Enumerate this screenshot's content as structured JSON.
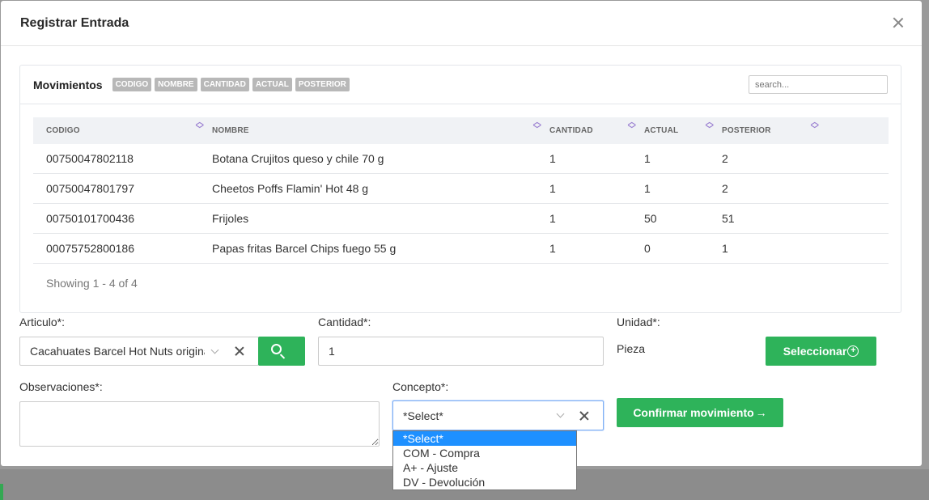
{
  "modal": {
    "title": "Registrar Entrada"
  },
  "movimientos": {
    "title": "Movimientos",
    "chips": [
      "CODIGO",
      "NOMBRE",
      "CANTIDAD",
      "ACTUAL",
      "POSTERIOR"
    ],
    "search_placeholder": "search...",
    "columns": [
      "CODIGO",
      "NOMBRE",
      "CANTIDAD",
      "ACTUAL",
      "POSTERIOR"
    ],
    "rows": [
      [
        "00750047802118",
        "Botana Crujitos queso y chile 70 g",
        "1",
        "1",
        "2"
      ],
      [
        "00750047801797",
        "Cheetos Poffs Flamin' Hot 48 g",
        "1",
        "1",
        "2"
      ],
      [
        "00750101700436",
        "Frijoles",
        "1",
        "50",
        "51"
      ],
      [
        "00075752800186",
        "Papas fritas Barcel Chips fuego 55 g",
        "1",
        "0",
        "1"
      ]
    ],
    "showing": "Showing 1 - 4 of 4"
  },
  "form": {
    "articulo_label": "Articulo*:",
    "articulo_value": "Cacahuates Barcel Hot Nuts original",
    "cantidad_label": "Cantidad*:",
    "cantidad_value": "1",
    "unidad_label": "Unidad*:",
    "unidad_value": "Pieza",
    "seleccionar_label": "Seleccionar",
    "observaciones_label": "Observaciones*:",
    "concepto_label": "Concepto*:",
    "concepto_value": "*Select*",
    "concepto_options": [
      "*Select*",
      "COM - Compra",
      "A+ - Ajuste",
      "DV - Devolución"
    ],
    "confirmar_label": "Confirmar movimiento"
  },
  "colors": {
    "accent": "#2eb35a",
    "highlight": "#1e90ff"
  }
}
